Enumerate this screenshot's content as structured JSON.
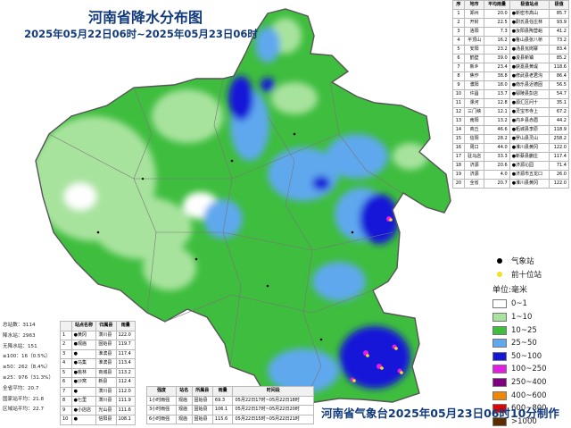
{
  "title": {
    "main": "河南省降水分布图",
    "sub": "2025年05月22日06时~2025年05月23日06时"
  },
  "map_colors": {
    "water": "#ffffff",
    "c_0_1": "#ffffff",
    "c_1_10": "#a8e39e",
    "c_10_25": "#3ebd3e",
    "c_25_50": "#5ea8ee",
    "c_50_100": "#1515d8",
    "c_100_250": "#e31de3",
    "boundary": "#555555"
  },
  "top_table": {
    "headers": [
      "序",
      "地市",
      "平均雨量",
      "极值站点",
      "极值"
    ],
    "rows": [
      [
        "1",
        "郑州",
        "20.0",
        "●新密市高山",
        "85.7"
      ],
      [
        "2",
        "开封",
        "22.5",
        "●尉氏县任庄林",
        "93.9"
      ],
      [
        "3",
        "洛阳",
        "7.3",
        "●汝阳县陶营峪",
        "41.2"
      ],
      [
        "4",
        "平顶山",
        "16.2",
        "●鲁山县张八桥",
        "73.2"
      ],
      [
        "5",
        "安阳",
        "23.2",
        "●汤县瓦岗寨",
        "83.4"
      ],
      [
        "6",
        "鹤壁",
        "39.0",
        "●浚县新镇",
        "85.2"
      ],
      [
        "7",
        "新乡",
        "23.4",
        "●获嘉县黄堤",
        "118.6"
      ],
      [
        "8",
        "焦作",
        "38.8",
        "●修武县老君沟",
        "86.4"
      ],
      [
        "9",
        "濮阳",
        "18.0",
        "●南乐县近德固",
        "56.5"
      ],
      [
        "10",
        "许昌",
        "13.7",
        "●鄢陵县彭店",
        "54.7"
      ],
      [
        "11",
        "漯河",
        "12.8",
        "●源汇区问十",
        "35.1"
      ],
      [
        "12",
        "三门峡",
        "12.1",
        "●灵宝市寺上",
        "67.2"
      ],
      [
        "13",
        "南阳",
        "13.2",
        "●内乡县赤眉",
        "44.2"
      ],
      [
        "14",
        "商丘",
        "46.6",
        "●柘城县李原",
        "118.9"
      ],
      [
        "15",
        "信阳",
        "28.2",
        "●罗山县灵山",
        "258.2"
      ],
      [
        "16",
        "周口",
        "44.0",
        "●淮川县黄冈",
        "122.0"
      ],
      [
        "17",
        "驻马店",
        "33.3",
        "●新蔡县蒯庄",
        "117.4"
      ],
      [
        "18",
        "济源",
        "20.6",
        "●济源沁园",
        "71.4"
      ],
      [
        "19",
        "济源",
        "4.0",
        "●济源市五龙口",
        "26.0"
      ],
      [
        "20",
        "全省",
        "20.7",
        "●淮川县黄冈",
        "122.0"
      ]
    ]
  },
  "legend": {
    "markers": [
      {
        "label": "气象站",
        "color": "#000000"
      },
      {
        "label": "前十位站",
        "color": "#f5e21a"
      }
    ],
    "unit": "单位:毫米",
    "items": [
      {
        "label": "0~1",
        "color": "#ffffff"
      },
      {
        "label": "1~10",
        "color": "#a8e39e"
      },
      {
        "label": "10~25",
        "color": "#3ebd3e"
      },
      {
        "label": "25~50",
        "color": "#5ea8ee"
      },
      {
        "label": "50~100",
        "color": "#1515d8"
      },
      {
        "label": "100~250",
        "color": "#e31de3"
      },
      {
        "label": "250~400",
        "color": "#800080"
      },
      {
        "label": "400~600",
        "color": "#f28500"
      },
      {
        "label": "600~800",
        "color": "#e60000"
      },
      {
        "label": ">1000",
        "color": "#5a2d00"
      }
    ]
  },
  "stats": [
    "总站数：3114",
    "降水站：2963",
    "无降水站：151",
    "≥100：16（0.5%）",
    "≥50：262（8.4%）",
    "≥25：976（31.3%）",
    "全省平均：20.7",
    "国家站平均：21.8",
    "区域站平均：22.7"
  ],
  "bl_table": {
    "headers": [
      "",
      "站点名称",
      "归属县",
      "雨量"
    ],
    "rows": [
      [
        "1",
        "●黄冈",
        "潢川县",
        "122.0"
      ],
      [
        "2",
        "●观庙",
        "固始县",
        "119.7"
      ],
      [
        "3",
        "●",
        "淮滨县",
        "117.4"
      ],
      [
        "4",
        "●马集",
        "淮滨县",
        "113.4"
      ],
      [
        "5",
        "●桃林",
        "商城县",
        "113.2"
      ],
      [
        "6",
        "●沙窝",
        "新县",
        "112.4"
      ],
      [
        "7",
        "●",
        "潢川县",
        "112.0"
      ],
      [
        "8",
        "●七里",
        "潢川县",
        "111.9"
      ],
      [
        "9",
        "●小店店",
        "光山县",
        "111.6"
      ],
      [
        "10",
        "●",
        "信阳县",
        "108.1"
      ]
    ]
  },
  "bm_table": {
    "headers": [
      "强度",
      "站名",
      "所属县",
      "雨量",
      "时间段"
    ],
    "rows": [
      [
        "1小时雨强",
        "观庙",
        "固始县",
        "69.3",
        "05月22日17时~05月22日18时"
      ],
      [
        "3小时雨强",
        "观庙",
        "固始县",
        "106.1",
        "05月22日17时~05月22日20时"
      ],
      [
        "6小时雨强",
        "观庙",
        "固始县",
        "115.6",
        "05月22日15时~05月22日21时"
      ]
    ]
  },
  "footer": "河南省气象台2025年05月23日06时10分制作"
}
